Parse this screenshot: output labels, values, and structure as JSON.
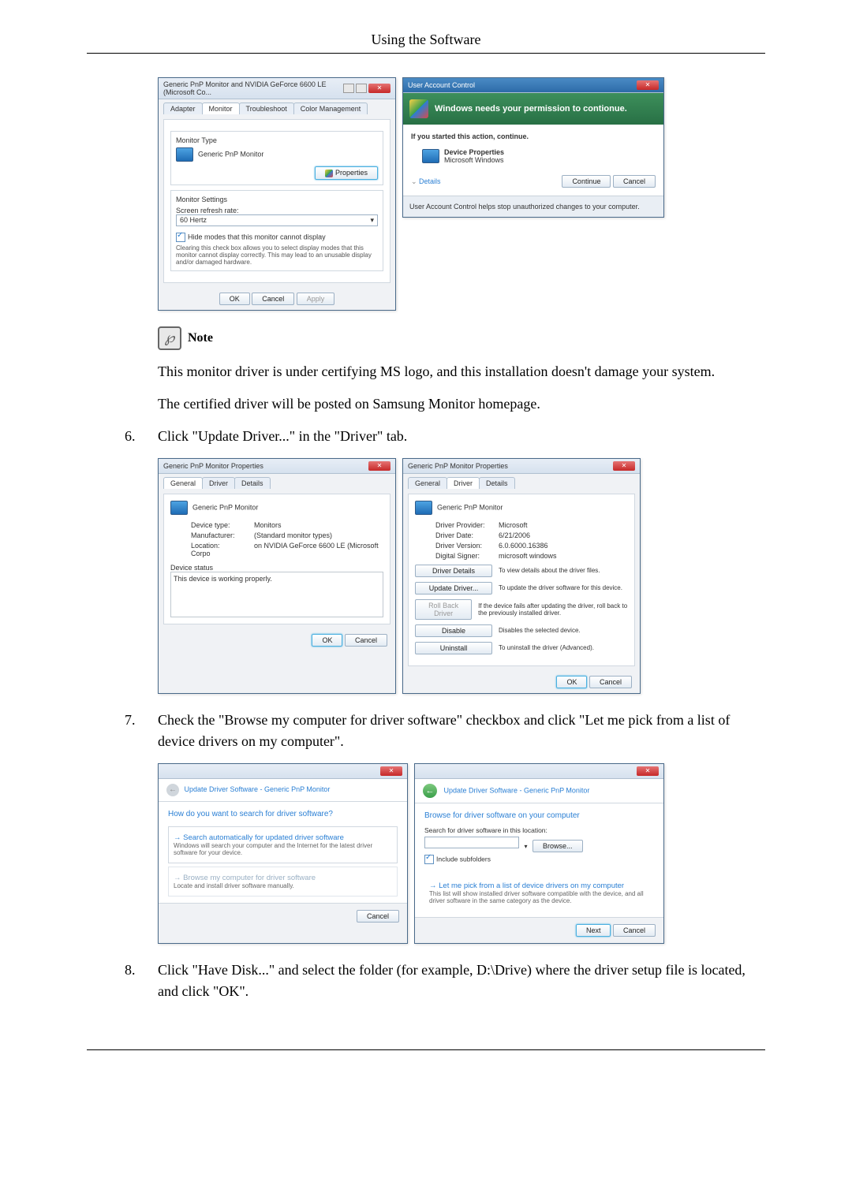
{
  "page_header": "Using the Software",
  "note": {
    "label": "Note"
  },
  "note_text1": "This monitor driver is under certifying MS logo, and this installation doesn't damage your system.",
  "note_text2": "The certified driver will be posted on Samsung Monitor homepage.",
  "step6": {
    "num": "6.",
    "text": "Click \"Update Driver...\" in the \"Driver\" tab."
  },
  "step7": {
    "num": "7.",
    "text": "Check the \"Browse my computer for driver software\" checkbox and click \"Let me pick from a list of device drivers on my computer\"."
  },
  "step8": {
    "num": "8.",
    "text": "Click \"Have Disk...\" and select the folder (for example, D:\\Drive) where the driver setup file is located, and click \"OK\"."
  },
  "dlg_monitor": {
    "title": "Generic PnP Monitor and NVIDIA GeForce 6600 LE (Microsoft Co...",
    "tabs": [
      "Adapter",
      "Monitor",
      "Troubleshoot",
      "Color Management"
    ],
    "group_type": "Monitor Type",
    "device_name": "Generic PnP Monitor",
    "properties_btn": "Properties",
    "group_settings": "Monitor Settings",
    "refresh_label": "Screen refresh rate:",
    "refresh_value": "60 Hertz",
    "hide_modes": "Hide modes that this monitor cannot display",
    "hide_desc": "Clearing this check box allows you to select display modes that this monitor cannot display correctly. This may lead to an unusable display and/or damaged hardware.",
    "ok": "OK",
    "cancel": "Cancel",
    "apply": "Apply"
  },
  "dlg_uac": {
    "title": "User Account Control",
    "banner": "Windows needs your permission to contionue.",
    "started": "If you started this action, continue.",
    "app_name": "Device Properties",
    "publisher": "Microsoft Windows",
    "details": "Details",
    "continue": "Continue",
    "cancel": "Cancel",
    "footer": "User Account Control helps stop unauthorized changes to your computer."
  },
  "dlg_props_general": {
    "title": "Generic PnP Monitor Properties",
    "tabs": [
      "General",
      "Driver",
      "Details"
    ],
    "name": "Generic PnP Monitor",
    "rows": {
      "type_l": "Device type:",
      "type_v": "Monitors",
      "mfr_l": "Manufacturer:",
      "mfr_v": "(Standard monitor types)",
      "loc_l": "Location:",
      "loc_v": "on NVIDIA GeForce 6600 LE (Microsoft Corpo"
    },
    "status_l": "Device status",
    "status_v": "This device is working properly.",
    "ok": "OK",
    "cancel": "Cancel"
  },
  "dlg_props_driver": {
    "title": "Generic PnP Monitor Properties",
    "tabs": [
      "General",
      "Driver",
      "Details"
    ],
    "name": "Generic PnP Monitor",
    "rows": {
      "prov_l": "Driver Provider:",
      "prov_v": "Microsoft",
      "date_l": "Driver Date:",
      "date_v": "6/21/2006",
      "ver_l": "Driver Version:",
      "ver_v": "6.0.6000.16386",
      "sig_l": "Digital Signer:",
      "sig_v": "microsoft windows"
    },
    "btn_details": "Driver Details",
    "desc_details": "To view details about the driver files.",
    "btn_update": "Update Driver...",
    "desc_update": "To update the driver software for this device.",
    "btn_rollback": "Roll Back Driver",
    "desc_rollback": "If the device fails after updating the driver, roll back to the previously installed driver.",
    "btn_disable": "Disable",
    "desc_disable": "Disables the selected device.",
    "btn_uninstall": "Uninstall",
    "desc_uninstall": "To uninstall the driver (Advanced).",
    "ok": "OK",
    "cancel": "Cancel"
  },
  "dlg_wiz1": {
    "crumb": "Update Driver Software - Generic PnP Monitor",
    "heading": "How do you want to search for driver software?",
    "opt1_t": "Search automatically for updated driver software",
    "opt1_d": "Windows will search your computer and the Internet for the latest driver software for your device.",
    "opt2_t": "Browse my computer for driver software",
    "opt2_d": "Locate and install driver software manually.",
    "cancel": "Cancel"
  },
  "dlg_wiz2": {
    "crumb": "Update Driver Software - Generic PnP Monitor",
    "heading": "Browse for driver software on your computer",
    "search_l": "Search for driver software in this location:",
    "browse": "Browse...",
    "include": "Include subfolders",
    "letme_t": "Let me pick from a list of device drivers on my computer",
    "letme_d": "This list will show installed driver software compatible with the device, and all driver software in the same category as the device.",
    "next": "Next",
    "cancel": "Cancel"
  }
}
